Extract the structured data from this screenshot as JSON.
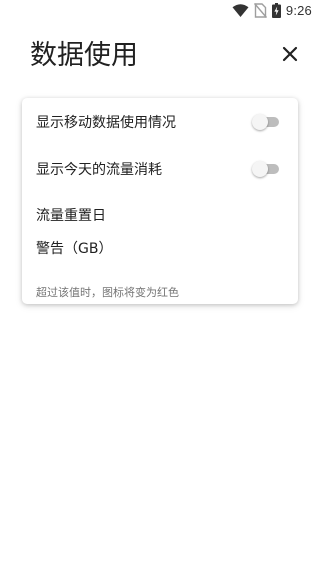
{
  "status_bar": {
    "time": "9:26",
    "icons": [
      "wifi-icon",
      "no-sim-icon",
      "battery-charging-icon"
    ]
  },
  "header": {
    "title": "数据使用",
    "close_icon": "close-icon"
  },
  "settings": {
    "show_mobile_data": {
      "label": "显示移动数据使用情况",
      "enabled": false
    },
    "show_today_usage": {
      "label": "显示今天的流量消耗",
      "enabled": false
    },
    "reset_day": {
      "label": "流量重置日"
    },
    "warning": {
      "label": "警告（GB）",
      "description": "超过该值时，图标将变为红色"
    }
  },
  "colors": {
    "toggle_track_off": "#bdbdbd",
    "toggle_thumb_off": "#f5f5f5",
    "text_primary": "#212121",
    "text_secondary": "#757575"
  }
}
